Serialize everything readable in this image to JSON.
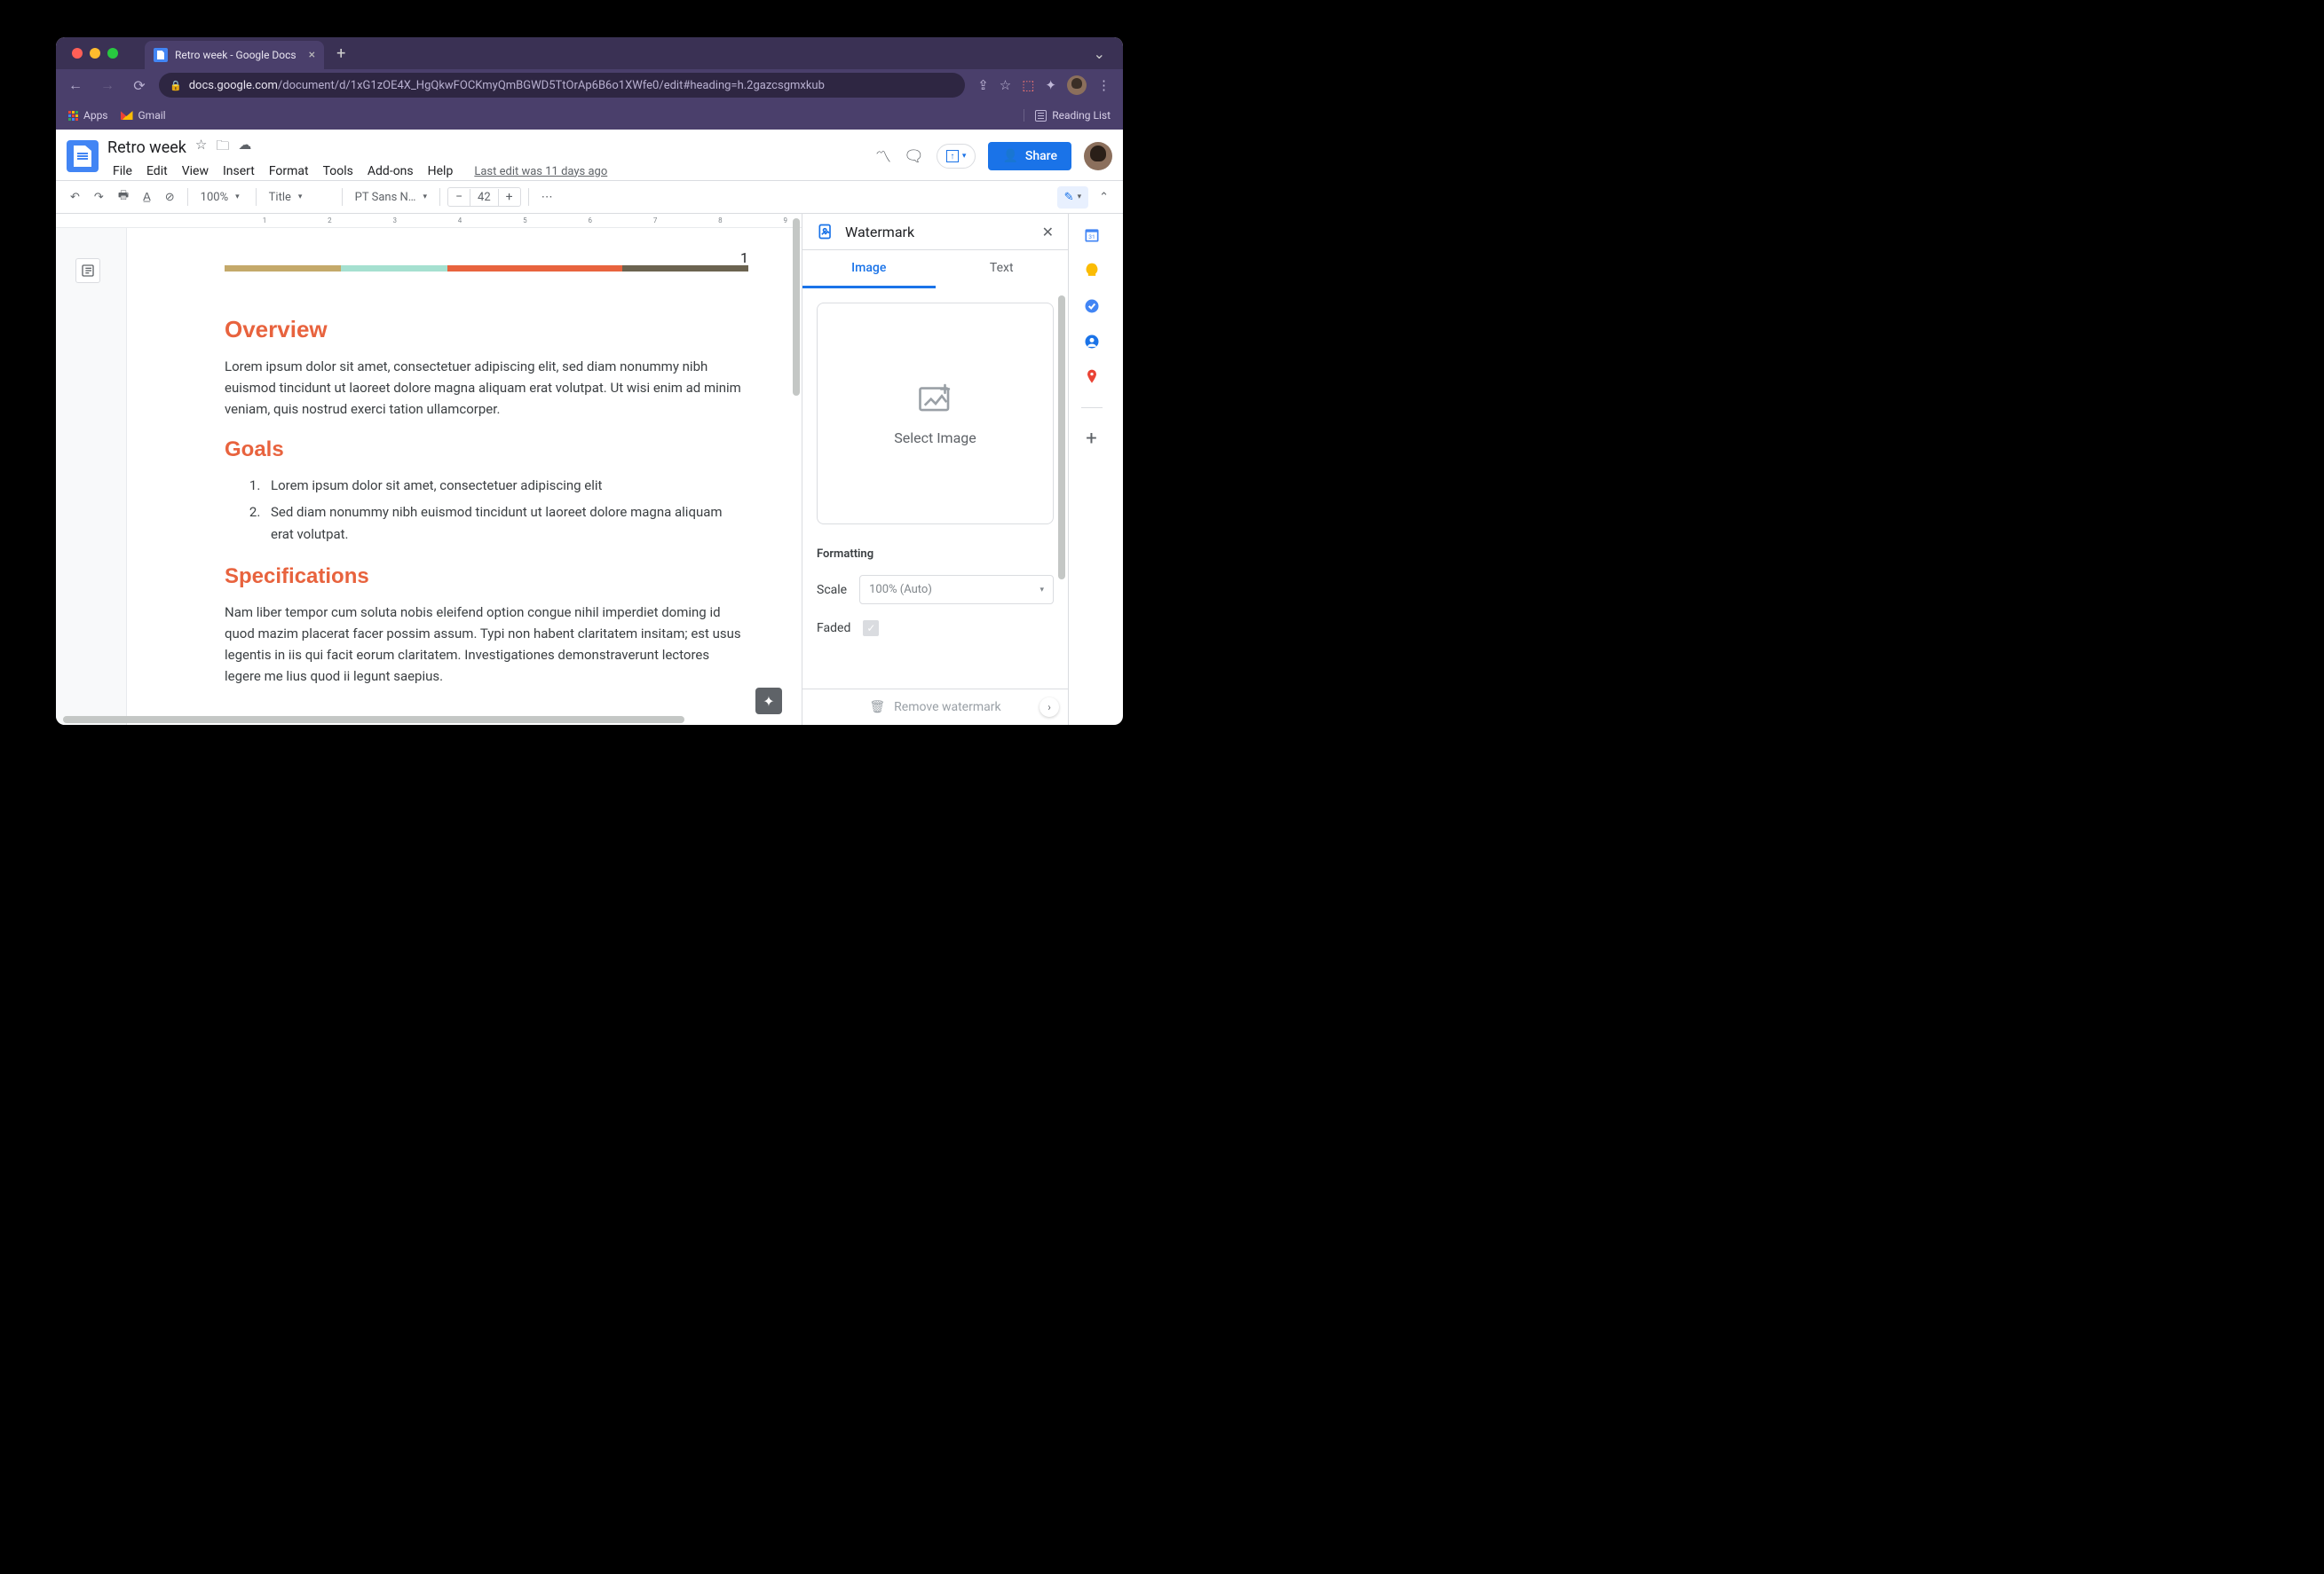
{
  "browser": {
    "tab_title": "Retro week - Google Docs",
    "url_domain": "docs.google.com",
    "url_path": "/document/d/1xG1zOE4X_HgQkwFOCKmyQmBGWD5TtOrAp6B6o1XWfe0/edit#heading=h.2gazcsgmxkub",
    "bookmarks": {
      "apps": "Apps",
      "gmail": "Gmail",
      "reading_list": "Reading List"
    }
  },
  "docs": {
    "title": "Retro week",
    "menus": [
      "File",
      "Edit",
      "View",
      "Insert",
      "Format",
      "Tools",
      "Add-ons",
      "Help"
    ],
    "last_edit": "Last edit was 11 days ago",
    "share_label": "Share"
  },
  "toolbar": {
    "zoom": "100%",
    "style": "Title",
    "font": "PT Sans N…",
    "font_size": "42"
  },
  "ruler_marks": [
    "",
    "1",
    "",
    "2",
    "",
    "3",
    "",
    "4",
    "",
    "5",
    "",
    "6",
    "",
    "7",
    "",
    "8",
    "",
    "9"
  ],
  "document": {
    "page_number": "1",
    "sections": {
      "overview": {
        "heading": "Overview",
        "body": "Lorem ipsum dolor sit amet, consectetuer adipiscing elit, sed diam nonummy nibh euismod tincidunt ut laoreet dolore magna aliquam erat volutpat. Ut wisi enim ad minim veniam, quis nostrud exerci tation ullamcorper."
      },
      "goals": {
        "heading": "Goals",
        "items": [
          "Lorem ipsum dolor sit amet, consectetuer adipiscing elit",
          "Sed diam nonummy nibh euismod tincidunt ut laoreet dolore magna aliquam erat volutpat."
        ]
      },
      "specs": {
        "heading": "Specifications",
        "body": "Nam liber tempor cum soluta nobis eleifend option congue nihil imperdiet doming id quod mazim placerat facer possim assum. Typi non habent claritatem insitam; est usus legentis in iis qui facit eorum claritatem. Investigationes demonstraverunt lectores legere me lius quod ii legunt saepius."
      }
    }
  },
  "sidepanel": {
    "title": "Watermark",
    "tabs": {
      "image": "Image",
      "text": "Text"
    },
    "select_image": "Select Image",
    "formatting_label": "Formatting",
    "scale_label": "Scale",
    "scale_value": "100% (Auto)",
    "faded_label": "Faded",
    "remove_label": "Remove watermark"
  }
}
